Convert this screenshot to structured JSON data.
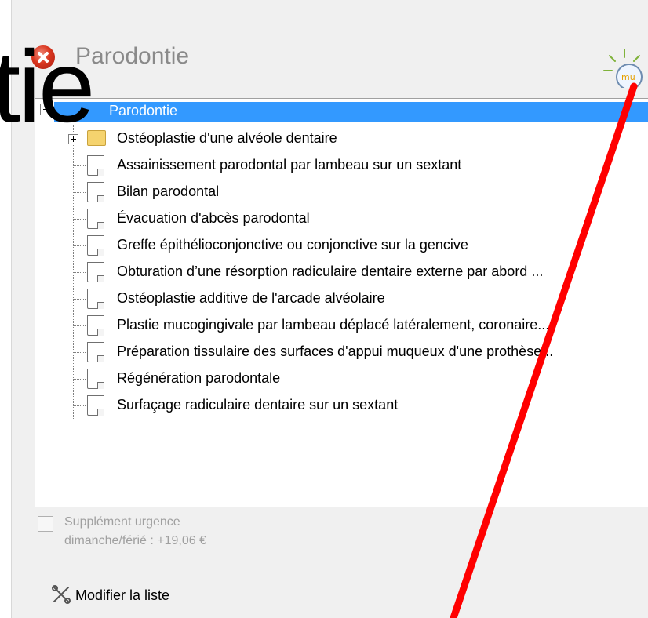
{
  "header": {
    "title": "Parodontie",
    "overlay_text": "tie"
  },
  "tree": {
    "root_label": "Parodontie",
    "items": [
      {
        "label": "Ostéoplastie d'une alvéole dentaire",
        "type": "folder"
      },
      {
        "label": "Assainissement parodontal par lambeau sur un sextant",
        "type": "doc"
      },
      {
        "label": "Bilan parodontal",
        "type": "doc"
      },
      {
        "label": "Évacuation d'abcès parodontal",
        "type": "doc"
      },
      {
        "label": "Greffe épithélioconjonctive ou conjonctive sur la gencive",
        "type": "doc"
      },
      {
        "label": "Obturation d’une résorption radiculaire dentaire externe par abord ...",
        "type": "doc"
      },
      {
        "label": "Ostéoplastie additive de l'arcade alvéolaire",
        "type": "doc"
      },
      {
        "label": "Plastie mucogingivale par lambeau déplacé latéralement, coronaire...",
        "type": "doc"
      },
      {
        "label": "Préparation tissulaire des surfaces d'appui muqueux d'une prothèse...",
        "type": "doc"
      },
      {
        "label": "Régénération parodontale",
        "type": "doc"
      },
      {
        "label": "Surfaçage radiculaire dentaire sur un sextant",
        "type": "doc"
      }
    ]
  },
  "footer": {
    "supplement_line1": "Supplément urgence",
    "supplement_line2": "dimanche/férié : +19,06 €",
    "modify_label": "Modifier la liste"
  },
  "icons": {
    "close": "close-icon",
    "sun": "sun-icon",
    "folder": "folder-icon",
    "document": "document-icon",
    "tools": "tools-icon"
  },
  "colors": {
    "selection": "#3399ff",
    "overlay_line": "#ff0000"
  }
}
